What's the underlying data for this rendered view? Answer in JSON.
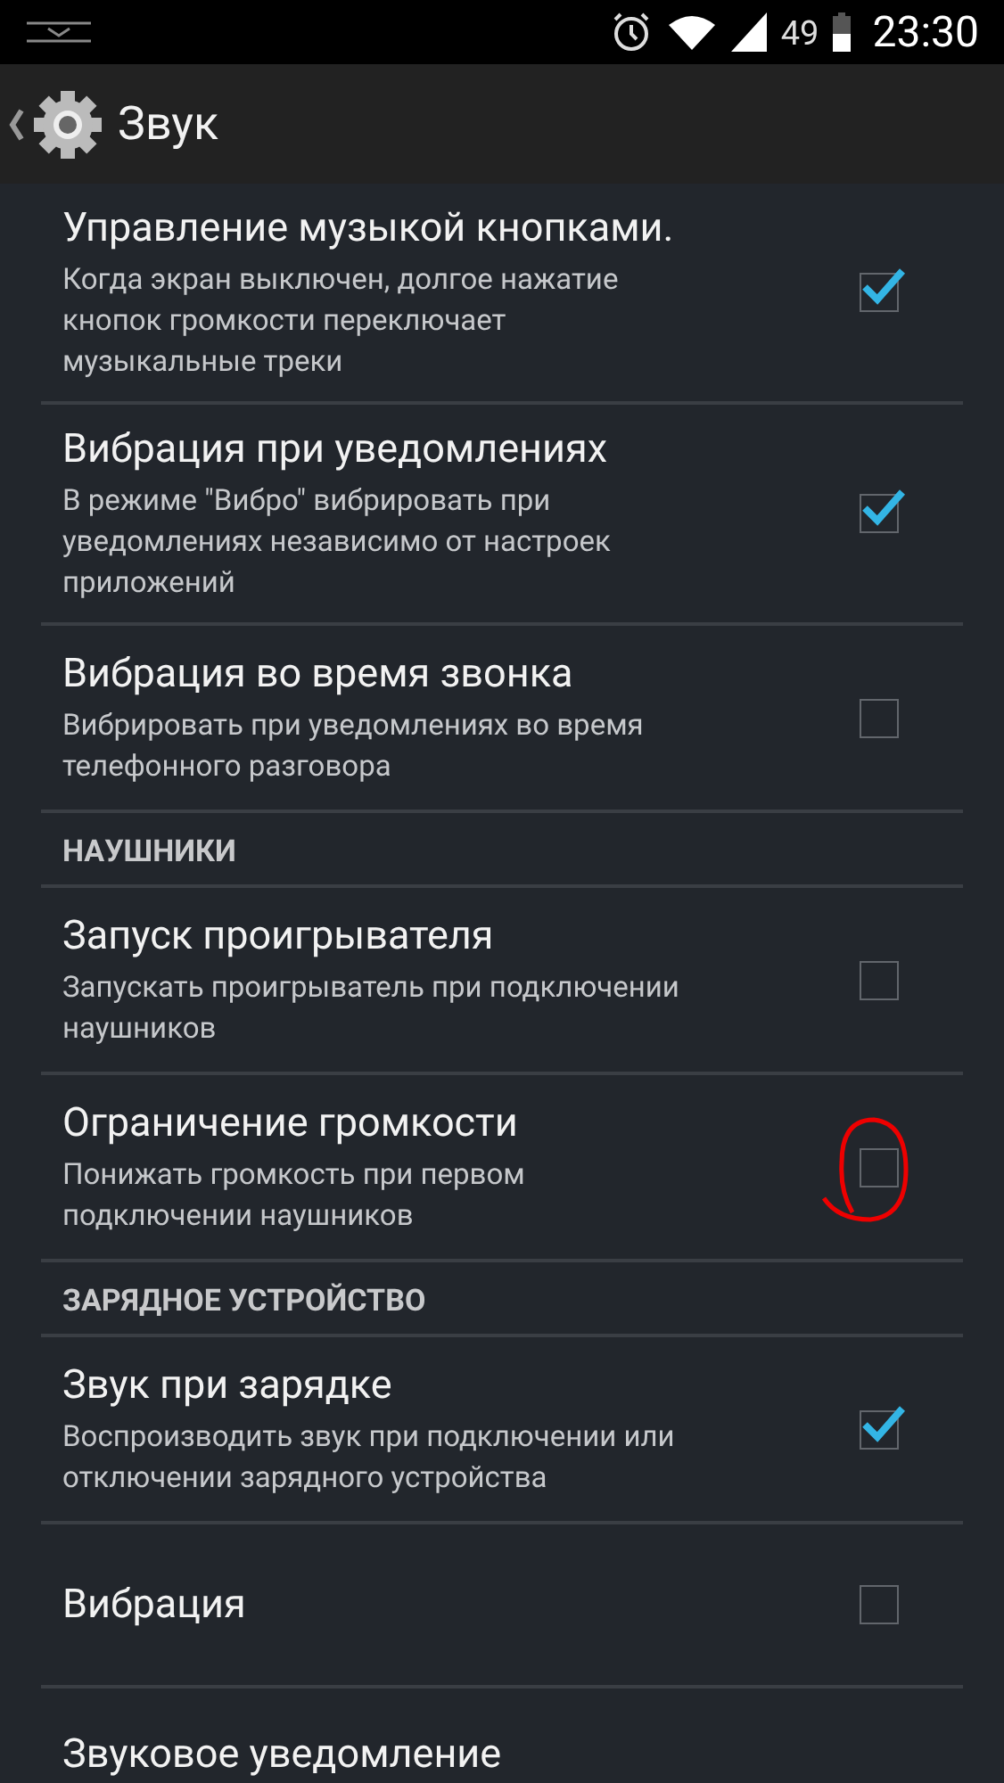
{
  "status_bar": {
    "battery": "49",
    "time": "23:30"
  },
  "action_bar": {
    "title": "Звук"
  },
  "items": [
    {
      "kind": "setting",
      "title": "Управление музыкой кнопками.",
      "summary": "Когда экран выключен, долгое нажатие кнопок громкости переключает музыкальные треки",
      "checked": true,
      "circled": false
    },
    {
      "kind": "setting",
      "title": "Вибрация при уведомлениях",
      "summary": "В режиме \"Вибро\" вибрировать при уведомлениях независимо от настроек приложений",
      "checked": true,
      "circled": false
    },
    {
      "kind": "setting",
      "title": "Вибрация во время звонка",
      "summary": "Вибрировать при уведомлениях во время телефонного разговора",
      "checked": false,
      "circled": false
    },
    {
      "kind": "header",
      "title": "НАУШНИКИ"
    },
    {
      "kind": "setting",
      "title": "Запуск проигрывателя",
      "summary": "Запускать проигрыватель при подключении наушников",
      "checked": false,
      "circled": false
    },
    {
      "kind": "setting",
      "title": "Ограничение громкости",
      "summary": "Понижать громкость при первом подключении наушников",
      "checked": false,
      "circled": true
    },
    {
      "kind": "header",
      "title": "ЗАРЯДНОЕ УСТРОЙСТВО"
    },
    {
      "kind": "setting",
      "title": "Звук при зарядке",
      "summary": "Воспроизводить звук при подключении или отключении зарядного устройства",
      "checked": true,
      "circled": false
    },
    {
      "kind": "setting",
      "title": "Вибрация",
      "checked": false,
      "circled": false
    },
    {
      "kind": "plain",
      "title": "Звуковое уведомление"
    }
  ]
}
